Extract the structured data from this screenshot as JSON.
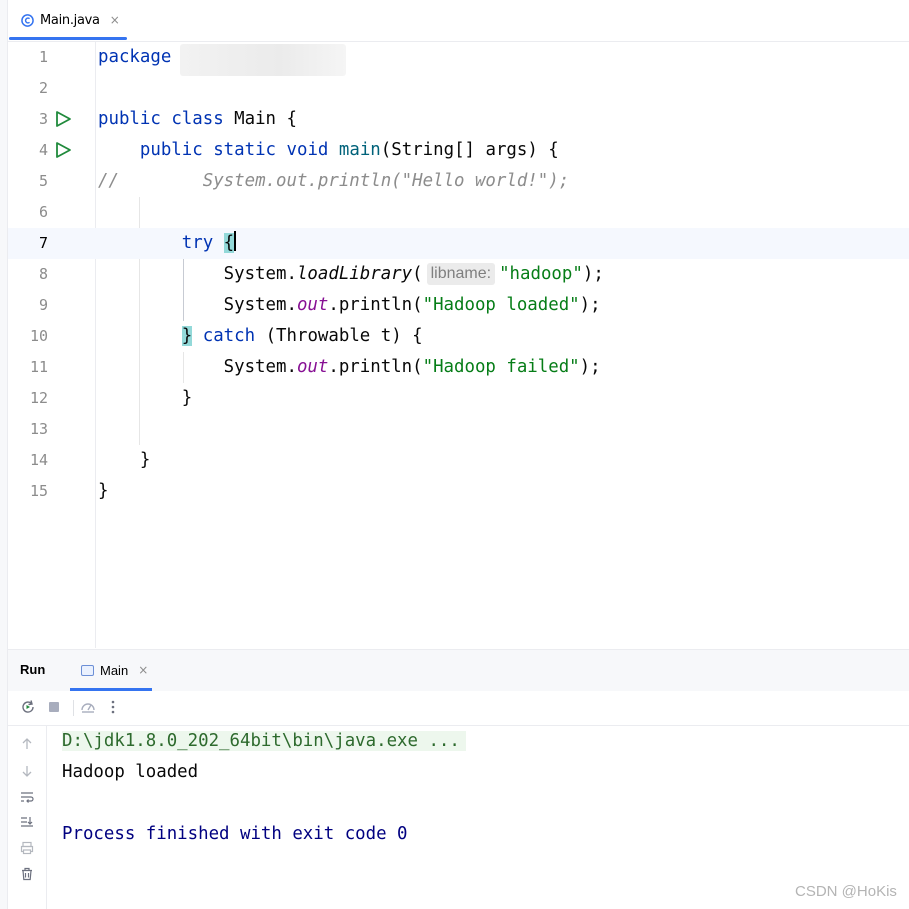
{
  "editor_tab": {
    "label": "Main.java",
    "close": "×"
  },
  "code": {
    "line_numbers": [
      "1",
      "2",
      "3",
      "4",
      "5",
      "6",
      "7",
      "8",
      "9",
      "10",
      "11",
      "12",
      "13",
      "14",
      "15"
    ],
    "l1": {
      "kw": "package"
    },
    "l3": {
      "kw1": "public",
      "kw2": "class",
      "rest": " Main {"
    },
    "l4": {
      "kw1": "public",
      "kw2": "static",
      "kw3": "void",
      "fn": "main",
      "rest": "(String[] args) {"
    },
    "l5": {
      "slashes": "//",
      "comment": "System.out.println(\"Hello world!\");"
    },
    "l7": {
      "kw": "try",
      "brace": "{"
    },
    "l8": {
      "pre": "System.",
      "method": "loadLibrary",
      "paren": "(",
      "hint": "libname:",
      "str": "\"hadoop\"",
      "post": ");"
    },
    "l9": {
      "pre": "System.",
      "field": "out",
      "mid": ".println(",
      "str": "\"Hadoop loaded\"",
      "post": ");"
    },
    "l10": {
      "brace": "}",
      "kw": "catch",
      "rest": " (Throwable t) {"
    },
    "l11": {
      "pre": "System.",
      "field": "out",
      "mid": ".println(",
      "str": "\"Hadoop failed\"",
      "post": ");"
    },
    "l12": {
      "text": "}"
    },
    "l14": {
      "text": "}"
    },
    "l15": {
      "text": "}"
    }
  },
  "run_panel": {
    "title": "Run",
    "tab_label": "Main",
    "tab_close": "×",
    "console": {
      "command": "D:\\jdk1.8.0_202_64bit\\bin\\java.exe ...",
      "output": "Hadoop loaded",
      "exit": "Process finished with exit code 0"
    }
  },
  "watermark": "CSDN @HoKis",
  "colors": {
    "keyword": "#0033b3",
    "string": "#067d17",
    "field": "#871094",
    "accent": "#3574f0",
    "run_green": "#208a3c"
  }
}
